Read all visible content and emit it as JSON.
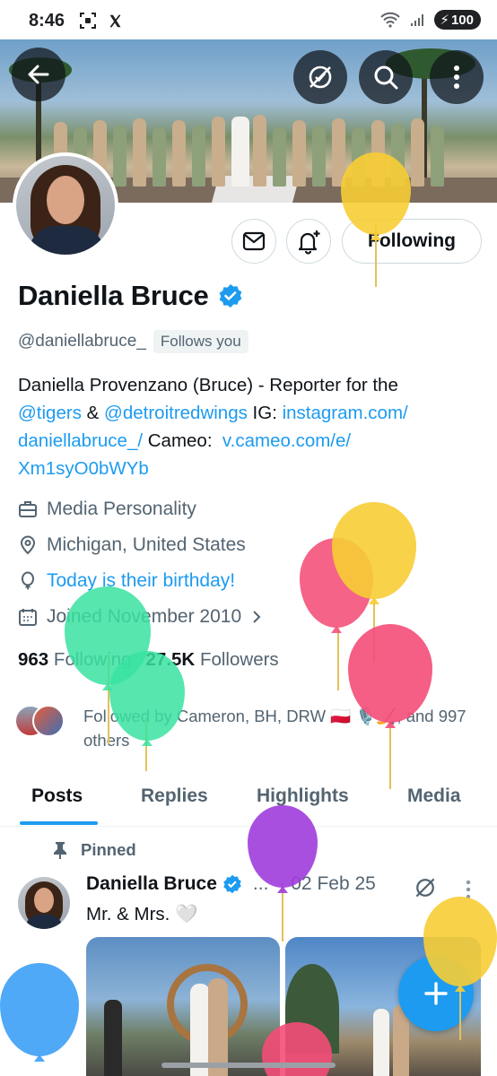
{
  "status_bar": {
    "time": "8:46",
    "network": "5",
    "battery": "100"
  },
  "header": {
    "back_icon": "arrow-left-icon",
    "premium_icon": "verified-slash-icon",
    "search_icon": "search-icon",
    "more_icon": "more-vertical-icon"
  },
  "profile": {
    "display_name": "Daniella Bruce",
    "handle": "@daniellabruce_",
    "follows_you": "Follows you",
    "following_label": "Following",
    "bio": {
      "line1": "Daniella Provenzano (Bruce) - Reporter for the",
      "mention1": "@tigers",
      "amp": " & ",
      "mention2": "@detroitredwings",
      "ig_label": " IG: ",
      "ig_link_a": "instagram.com/",
      "ig_link_b": "daniellabruce_/",
      "cameo_label": " Cameo:  ",
      "cameo_link_a": "v.cameo.com/e/",
      "cameo_link_b": "Xm1syO0bWYb"
    },
    "category": "Media Personality",
    "location": "Michigan, United States",
    "birthday": "Today is their birthday!",
    "joined": "Joined November 2010",
    "following_count": "963",
    "following_word": "Following",
    "followers_count": "27.5K",
    "followers_word": "Followers",
    "followed_by": "Followed by Cameron, BH, DRW 🇵🇱 🎙️🏒, and 997 others"
  },
  "tabs": [
    "Posts",
    "Replies",
    "Highlights",
    "Media"
  ],
  "pinned_post": {
    "pinned_label": "Pinned",
    "author": "Daniella Bruce",
    "ellipsis": "...",
    "date": "· 02 Feb 25",
    "text": "Mr. & Mrs. 🤍"
  },
  "fab": {
    "icon": "compose-plus-icon"
  },
  "colors": {
    "accent": "#1d9bf0",
    "text": "#0f1419",
    "muted": "#536471"
  }
}
